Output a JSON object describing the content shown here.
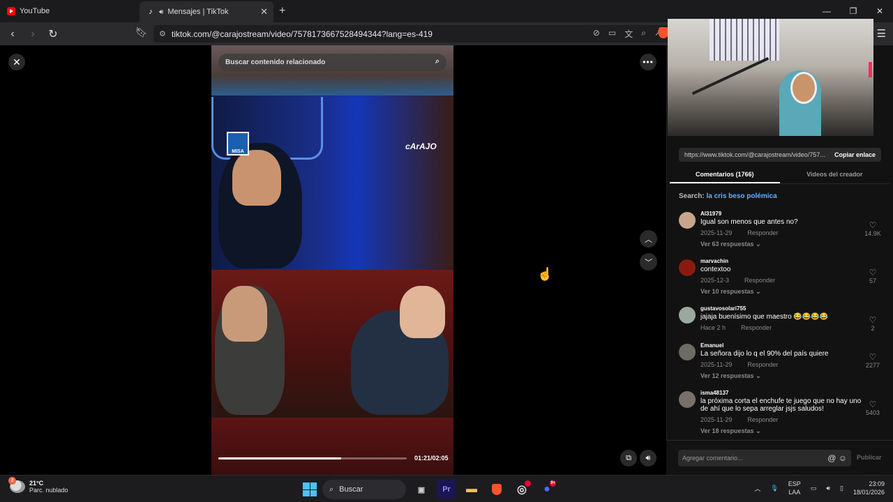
{
  "browser": {
    "tabs": [
      {
        "label": "YouTube",
        "icon": "youtube-icon"
      },
      {
        "label": "Mensajes | TikTok",
        "icon": "tiktok-icon",
        "active": true
      }
    ],
    "url": "tiktok.com/@carajostream/video/7578173667528494344?lang=es-419"
  },
  "player": {
    "search_placeholder": "Buscar contenido relacionado",
    "overlay_logo": "cArAJO",
    "misa_logo": "MISA",
    "time": "01:21/02:05",
    "progress": 0.65
  },
  "side": {
    "link": "https://www.tiktok.com/@carajostream/video/757...",
    "copy_label": "Copiar enlace",
    "tabs": [
      "Comentarios (1766)",
      "Videos del creador"
    ],
    "search_prefix": "Search:",
    "search_term": "la cris beso polémica",
    "comments": [
      {
        "user": "Al31979",
        "text": "Igual son menos que antes no?",
        "date": "2025-11-29",
        "reply": "Responder",
        "replies": "Ver 63 respuestas",
        "likes": "14.9K"
      },
      {
        "user": "marvachin",
        "text": "contextoo",
        "date": "2025-12-3",
        "reply": "Responder",
        "replies": "Ver 10 respuestas",
        "likes": "57"
      },
      {
        "user": "gustavosolari755",
        "text": "jajaja buenísimo que maestro 😂😂😂😂",
        "date": "Hace 2 h",
        "reply": "Responder",
        "replies": "",
        "likes": "2"
      },
      {
        "user": "Emanuel",
        "text": "La señora dijo lo q el 90% del país quiere",
        "date": "2025-11-29",
        "reply": "Responder",
        "replies": "Ver 12 respuestas",
        "likes": "2277"
      },
      {
        "user": "isma48137",
        "text": "la próxima corta el enchufe te juego que no hay uno de ahí que lo sepa arreglar jsjs saludos!",
        "date": "2025-11-29",
        "reply": "Responder",
        "replies": "Ver 18 respuestas",
        "likes": "5403"
      }
    ],
    "add_comment": "Agregar comentario...",
    "publish": "Publicar"
  },
  "taskbar": {
    "temp": "21°C",
    "weather": "Parc. nublado",
    "weather_badge": "3",
    "search": "Buscar",
    "lang1": "ESP",
    "lang2": "LAA",
    "time": "23:09",
    "date": "18/01/2026",
    "discord_badge": "9+"
  }
}
